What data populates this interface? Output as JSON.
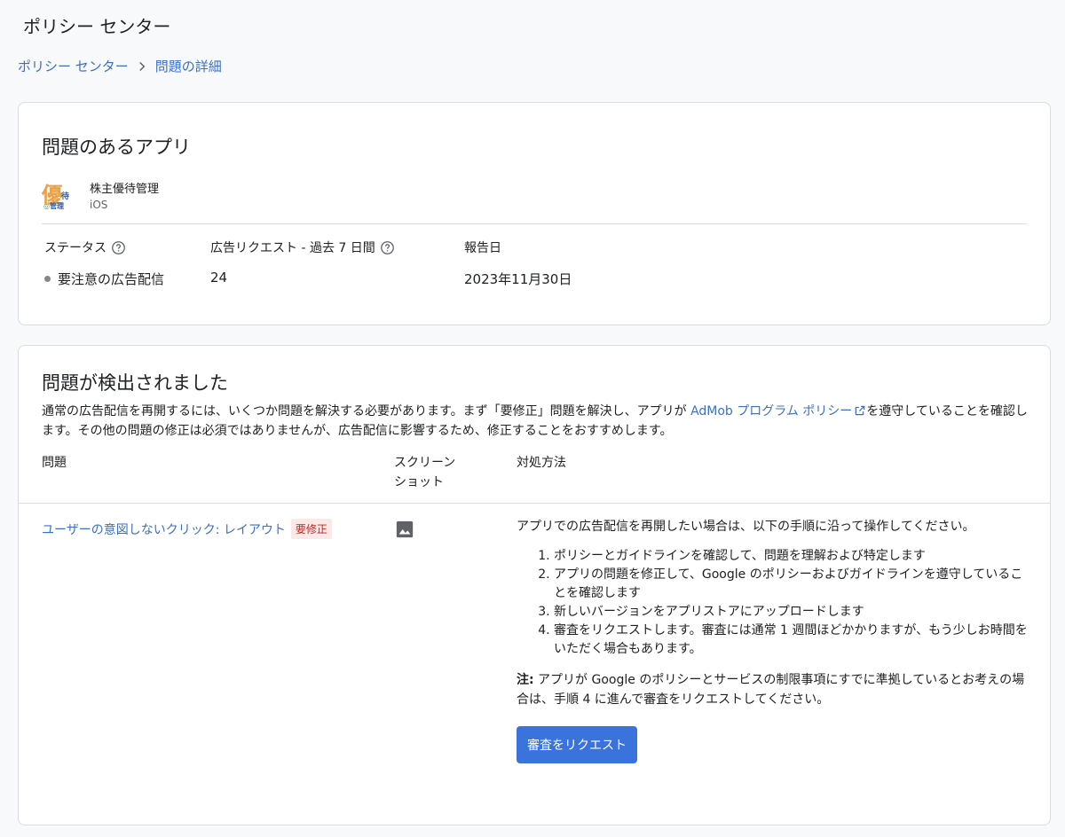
{
  "header": {
    "title": "ポリシー センター"
  },
  "breadcrumb": {
    "root": "ポリシー センター",
    "current": "問題の詳細"
  },
  "app_card": {
    "title": "問題のあるアプリ",
    "app": {
      "icon_main": "優",
      "icon_sub1": "待",
      "icon_sub2a": "◎",
      "icon_sub2b": "管理",
      "name": "株主優待管理",
      "platform": "iOS"
    },
    "stats": {
      "status_label": "ステータス",
      "status_value": "要注意の広告配信",
      "requests_label": "広告リクエスト - 過去 7 日間",
      "requests_value": "24",
      "reported_label": "報告日",
      "reported_value": "2023年11月30日"
    }
  },
  "issues_card": {
    "title": "問題が検出されました",
    "intro_before": "通常の広告配信を再開するには、いくつか問題を解決する必要があります。まず「要修正」問題を解決し、アプリが ",
    "intro_link": "AdMob プログラム ポリシー",
    "intro_after": "を遵守していることを確認します。その他の問題の修正は必須ではありませんが、広告配信に影響するため、修正することをおすすめします。",
    "columns": {
      "issue": "問題",
      "screenshot_1": "スクリーン",
      "screenshot_2": "ショット",
      "resolution": "対処方法"
    },
    "issue": {
      "link": "ユーザーの意図しないクリック: レイアウト",
      "badge": "要修正",
      "resolution_intro": "アプリでの広告配信を再開したい場合は、以下の手順に沿って操作してください。",
      "steps": [
        "ポリシーとガイドラインを確認して、問題を理解および特定します",
        "アプリの問題を修正して、Google のポリシーおよびガイドラインを遵守していることを確認します",
        "新しいバージョンをアプリストアにアップロードします",
        "審査をリクエストします。審査には通常 1 週間ほどかかりますが、もう少しお時間をいただく場合もあります。"
      ],
      "note_label": "注:",
      "note_text": " アプリが Google のポリシーとサービスの制限事項にすでに準拠しているとお考えの場合は、手順 4 に進んで審査をリクエストしてください。",
      "button": "審査をリクエスト"
    }
  },
  "icons": {
    "help": "help-circle-icon",
    "external": "external-link-icon",
    "screenshot": "image-icon",
    "chevron": "chevron-right-icon"
  },
  "colors": {
    "link": "#3c6fc4",
    "button": "#3b73dc",
    "badge_bg": "#fce8e6",
    "badge_text": "#c5221f"
  }
}
